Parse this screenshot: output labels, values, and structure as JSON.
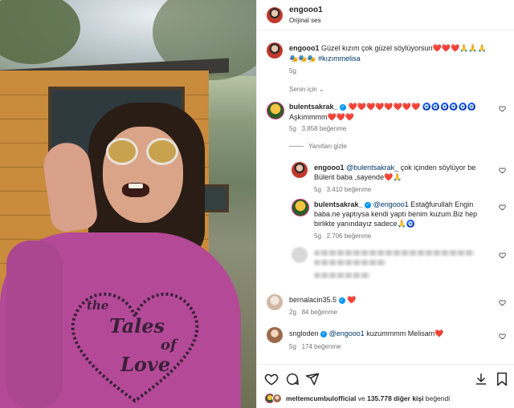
{
  "post": {
    "author": "engooo1",
    "audio": "Orijinal ses"
  },
  "caption": {
    "username": "engooo1",
    "text_line1": "Güzel kızım çok güzel söylüyorsun",
    "emojis_line1": "❤️❤️❤️🙏🙏🙏",
    "emojis_line2": "🎭🎭🎭",
    "hashtag": "#kızımmelisa",
    "time": "5g"
  },
  "sort_label": "Senin için",
  "comments": [
    {
      "username": "bulentsakrak_",
      "verified": true,
      "line1": "❤️❤️❤️❤️❤️❤️❤️❤️ 🧿🧿🧿🧿🧿🧿",
      "line2": "Aşkımmmm",
      "line2_emoji": "❤️❤️❤️",
      "time": "5g",
      "likes": "3.858 beğenme",
      "hide_replies": "Yanıtları gizle",
      "replies": [
        {
          "username": "engooo1",
          "mention": "@bulentsakrak_",
          "text1": " çok içinden söylüyor be",
          "text2": "Bülent baba ,sayende",
          "text2_emoji": "❤️🙏",
          "time": "5g",
          "likes": "3.410 beğenme"
        },
        {
          "username": "bulentsakrak_",
          "verified": true,
          "mention": "@engooo1",
          "text1": " Estağfurullah Engin",
          "text2": "baba.ne yaptıysa kendi yaptı benim kuzum.Biz hep",
          "text3": "birlikte yanındayız sadece",
          "text3_emoji": "🙏🧿",
          "time": "5g",
          "likes": "2.706 beğenme"
        }
      ]
    },
    {
      "username": "bernalacin35.5",
      "verified": true,
      "text": "",
      "emoji": "❤️",
      "time": "2g",
      "likes": "84 beğenme"
    },
    {
      "username": "sngloden",
      "verified": true,
      "mention": "@engooo1",
      "text": " kuzummmm Melisam",
      "emoji": "❤️",
      "time": "5g",
      "likes": "174 beğenme"
    }
  ],
  "liked_by": {
    "name": "meltemcumbulofficial",
    "connector": " ve ",
    "count": "135.778 diğer kişi",
    "suffix": " beğendi"
  },
  "icons": [
    "heart-icon",
    "comment-icon",
    "share-icon",
    "save-icon",
    "verified-badge-icon"
  ],
  "colors": {
    "heart_red": "#ed1b24",
    "link_blue": "#00376b",
    "verified_blue": "#0095f6",
    "muted": "#737373",
    "shirt_pink": "#b44a97"
  },
  "shirt_print": [
    "the",
    "Tales",
    "of",
    "Love"
  ]
}
